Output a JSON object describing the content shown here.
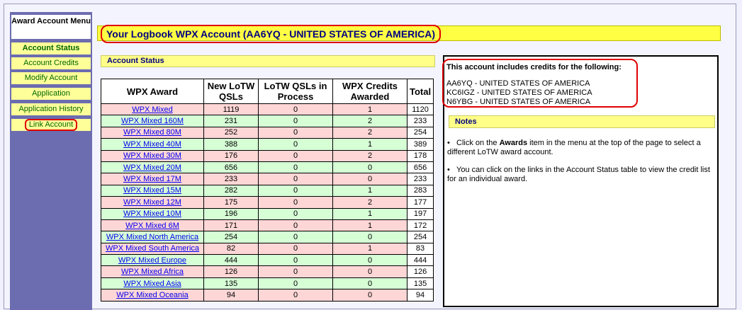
{
  "menu": {
    "title": "Award Account Menu",
    "items": [
      {
        "label": "Account Status"
      },
      {
        "label": "Account Credits"
      },
      {
        "label": "Modify Account"
      },
      {
        "label": "Application"
      },
      {
        "label": "Application History"
      },
      {
        "label": "Link Account"
      }
    ]
  },
  "page_title": "Your Logbook WPX Account (AA6YQ - UNITED STATES OF AMERICA)",
  "account_status": {
    "heading": "Account Status",
    "columns": [
      "WPX Award",
      "New LoTW QSLs",
      "LoTW QSLs in Process",
      "WPX Credits Awarded",
      "Total"
    ],
    "rows": [
      {
        "award": "WPX Mixed",
        "new": "1119",
        "process": "0",
        "awarded": "1",
        "total": "1120",
        "color": "pink"
      },
      {
        "award": "WPX Mixed 160M",
        "new": "231",
        "process": "0",
        "awarded": "2",
        "total": "233",
        "color": "green"
      },
      {
        "award": "WPX Mixed 80M",
        "new": "252",
        "process": "0",
        "awarded": "2",
        "total": "254",
        "color": "pink"
      },
      {
        "award": "WPX Mixed 40M",
        "new": "388",
        "process": "0",
        "awarded": "1",
        "total": "389",
        "color": "green"
      },
      {
        "award": "WPX Mixed 30M",
        "new": "176",
        "process": "0",
        "awarded": "2",
        "total": "178",
        "color": "pink"
      },
      {
        "award": "WPX Mixed 20M",
        "new": "656",
        "process": "0",
        "awarded": "0",
        "total": "656",
        "color": "green"
      },
      {
        "award": "WPX Mixed 17M",
        "new": "233",
        "process": "0",
        "awarded": "0",
        "total": "233",
        "color": "pink"
      },
      {
        "award": "WPX Mixed 15M",
        "new": "282",
        "process": "0",
        "awarded": "1",
        "total": "283",
        "color": "green"
      },
      {
        "award": "WPX Mixed 12M",
        "new": "175",
        "process": "0",
        "awarded": "2",
        "total": "177",
        "color": "pink"
      },
      {
        "award": "WPX Mixed 10M",
        "new": "196",
        "process": "0",
        "awarded": "1",
        "total": "197",
        "color": "green"
      },
      {
        "award": "WPX Mixed 6M",
        "new": "171",
        "process": "0",
        "awarded": "1",
        "total": "172",
        "color": "pink"
      },
      {
        "award": "WPX Mixed North America",
        "new": "254",
        "process": "0",
        "awarded": "0",
        "total": "254",
        "color": "green"
      },
      {
        "award": "WPX Mixed South America",
        "new": "82",
        "process": "0",
        "awarded": "1",
        "total": "83",
        "color": "pink"
      },
      {
        "award": "WPX Mixed Europe",
        "new": "444",
        "process": "0",
        "awarded": "0",
        "total": "444",
        "color": "green"
      },
      {
        "award": "WPX Mixed Africa",
        "new": "126",
        "process": "0",
        "awarded": "0",
        "total": "126",
        "color": "pink"
      },
      {
        "award": "WPX Mixed Asia",
        "new": "135",
        "process": "0",
        "awarded": "0",
        "total": "135",
        "color": "green"
      },
      {
        "award": "WPX Mixed Oceania",
        "new": "94",
        "process": "0",
        "awarded": "0",
        "total": "94",
        "color": "pink"
      }
    ]
  },
  "credits": {
    "heading": "This account includes credits for the following:",
    "calls": [
      "AA6YQ - UNITED STATES OF AMERICA",
      "KC6IGZ - UNITED STATES OF AMERICA",
      "N6YBG - UNITED STATES OF AMERICA"
    ]
  },
  "notes": {
    "heading": "Notes",
    "note1_pre": "Click on the ",
    "note1_bold": "Awards",
    "note1_post": " item in the menu at the top of the page to select a different LoTW award account.",
    "note2": "You can click on the links in the Account Status table to view the credit list for an individual award."
  },
  "colors": {
    "pink_row": "#ffd6d6",
    "green_row": "#d6ffd6",
    "menu_bg": "#6c6cb0",
    "highlight": "#e00000"
  }
}
